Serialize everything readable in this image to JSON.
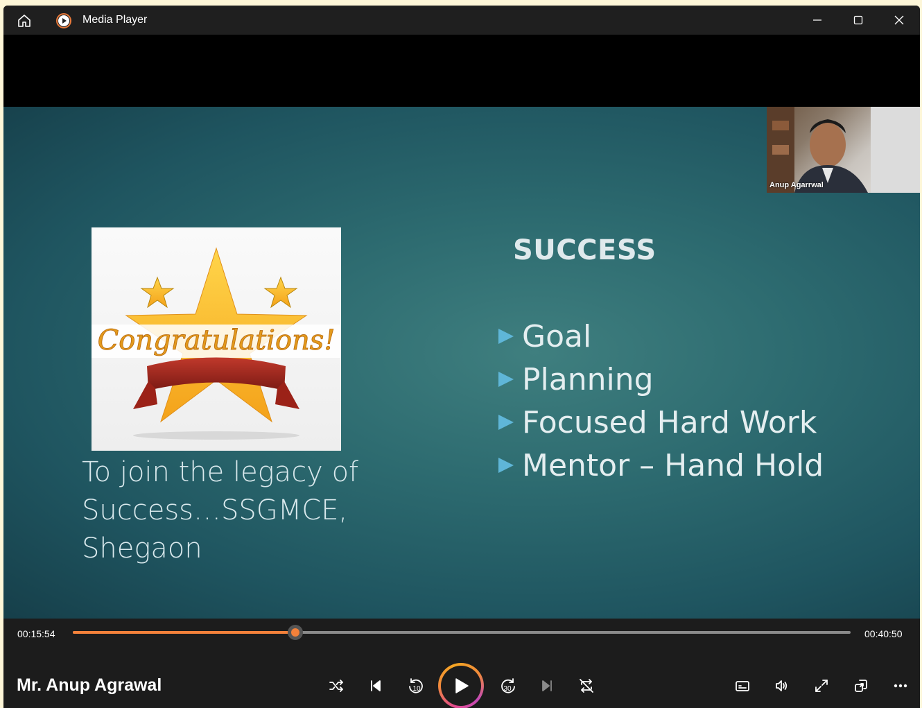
{
  "titlebar": {
    "app_title": "Media Player",
    "home_icon": "home-icon",
    "app_icon": "media-player-icon",
    "buttons": [
      "minimize-icon",
      "maximize-icon",
      "close-icon"
    ]
  },
  "slide": {
    "heading": "SUCCESS",
    "bullets": [
      "Goal",
      "Planning",
      "Focused Hard Work",
      "Mentor – Hand Hold"
    ],
    "caption_lines": [
      "To join the legacy of",
      "Success…SSGMCE,",
      "Shegaon"
    ],
    "image_text": "Congratulations!",
    "pip_name": "Anup Agarrwal",
    "bg_color": "#2d6b70",
    "bullet_color": "#5fb6d8"
  },
  "player": {
    "elapsed": "00:15:54",
    "total": "00:40:50",
    "progress_fraction": 0.2865,
    "now_playing_title": "Mr. Anup Agrawal",
    "accent_color": "#f3813a",
    "controls": {
      "shuffle": "shuffle-icon",
      "previous": "previous-icon",
      "skip_back": "skip-back-10-icon",
      "skip_back_label": "10",
      "play": "play-icon",
      "skip_forward": "skip-forward-30-icon",
      "skip_forward_label": "30",
      "next": "next-icon",
      "repeat": "repeat-off-icon",
      "captions": "captions-icon",
      "volume": "volume-icon",
      "fullscreen": "fullscreen-icon",
      "miniplayer": "miniplayer-icon",
      "more": "more-icon"
    }
  }
}
